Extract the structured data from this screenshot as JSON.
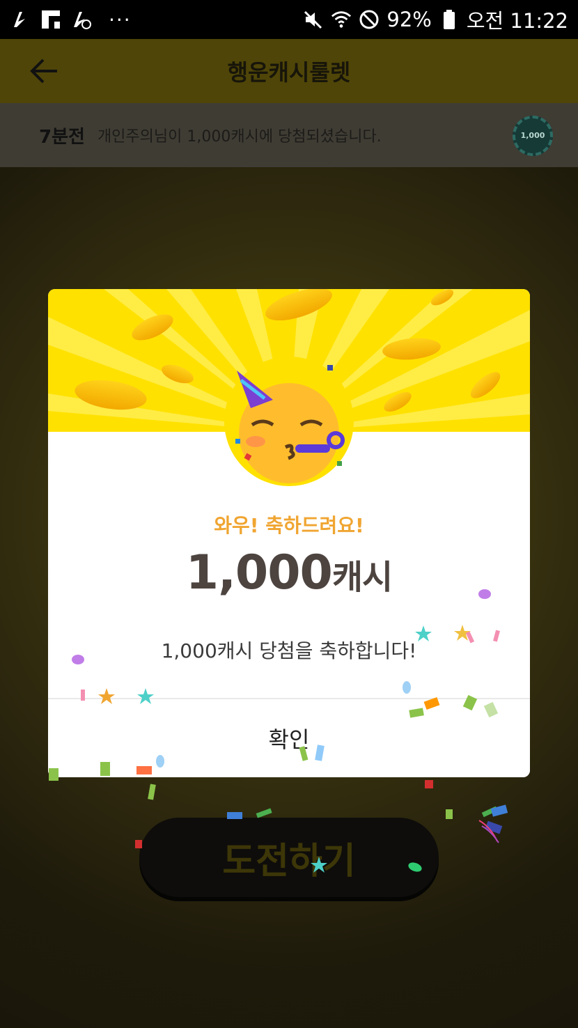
{
  "status_bar": {
    "battery": "92%",
    "time": "오전 11:22",
    "more_icon": "···"
  },
  "app_bar": {
    "title": "행운캐시룰렛",
    "back_icon": "arrow-left-icon"
  },
  "ticker": {
    "time_ago": "7분전",
    "message": "개인주의님이 1,000캐시에 당첨되셨습니다.",
    "chip_label": "1,000"
  },
  "dialog": {
    "subtitle": "와우! 축하드려요!",
    "amount": "1,000",
    "amount_unit": "캐시",
    "message": "1,000캐시 당첨을 축하합니다!",
    "confirm_label": "확인"
  },
  "main": {
    "challenge_label": "도전하기"
  },
  "colors": {
    "accent_yellow": "#ffe100",
    "subtitle_orange": "#f0a531",
    "amount_text": "#4d4440"
  }
}
